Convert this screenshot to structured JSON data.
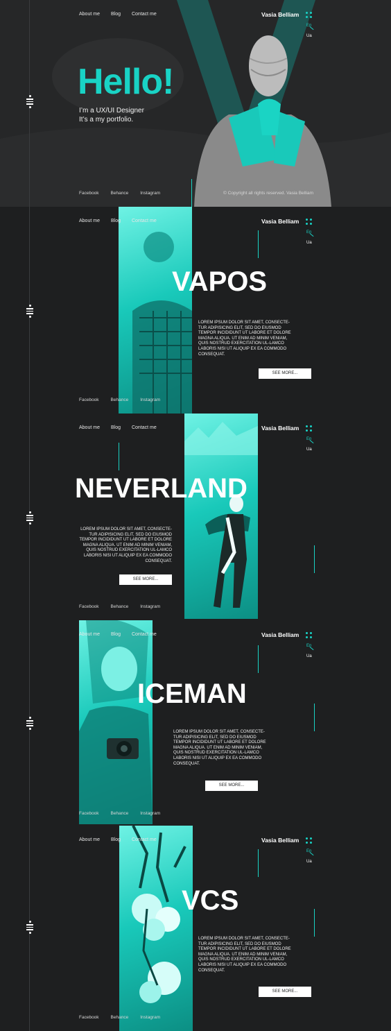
{
  "nav": {
    "about": "About me",
    "blog": "Blog",
    "contact": "Contact me"
  },
  "brand": "Vasia Belliam",
  "lang": {
    "en": "En",
    "ua": "Ua"
  },
  "social": {
    "facebook": "Facebook",
    "behance": "Behance",
    "instagram": "Instagram"
  },
  "hero": {
    "heading": "Hello!",
    "line1": "I’m a UX/UI Designer",
    "line2": "It’s a my portfolio.",
    "copyright": "© Copyright all rights reserved. Vasia Belliam"
  },
  "projects": [
    {
      "title": "VAPOS",
      "text": "LOREM IPSUM DOLOR SIT AMET, CONSECTE-TUR ADIPISICING ELIT, SED DO EIUSMOD TEMPOR INCIDIDUNT UT LABORE ET DOLORE MAGNA ALIQUA. UT ENIM AD MINIM VENIAM, QUIS NOSTRUD EXERCITATION UL-LAMCO LABORIS NISI UT ALIQUIP EX EA COMMODO CONSEQUAT.",
      "button": "SEE MORE..."
    },
    {
      "title": "NEVERLAND",
      "text": "LOREM IPSUM DOLOR SIT AMET, CONSECTE-TUR ADIPISICING ELIT, SED DO EIUSMOD TEMPOR INCIDIDUNT UT LABORE ET DOLORE MAGNA ALIQUA. UT ENIM AD MINIM VENIAM, QUIS NOSTRUD EXERCITATION UL-LAMCO LABORIS NISI UT ALIQUIP EX EA COMMODO CONSEQUAT.",
      "button": "SEE MORE..."
    },
    {
      "title": "ICEMAN",
      "text": "LOREM IPSUM DOLOR SIT AMET, CONSECTE-TUR ADIPISICING ELIT, SED DO EIUSMOD TEMPOR INCIDIDUNT UT LABORE ET DOLORE MAGNA ALIQUA. UT ENIM AD MINIM VENIAM, QUIS NOSTRUD EXERCITATION UL-LAMCO LABORIS NISI UT ALIQUIP EX EA COMMODO CONSEQUAT.",
      "button": "SEE MORE..."
    },
    {
      "title": "VCS",
      "text": "LOREM IPSUM DOLOR SIT AMET, CONSECTE-TUR ADIPISICING ELIT, SED DO EIUSMOD TEMPOR INCIDIDUNT UT LABORE ET DOLORE MAGNA ALIQUA. UT ENIM AD MINIM VENIAM, QUIS NOSTRUD EXERCITATION UL-LAMCO LABORIS NISI UT ALIQUIP EX EA COMMODO CONSEQUAT.",
      "button": "SEE MORE..."
    }
  ],
  "colors": {
    "accent": "#19d3c5",
    "background": "#1f2021",
    "button": "#ffffff"
  },
  "icons": {
    "menu": "hamburger-menu-icon",
    "grid": "grid-dots-icon"
  }
}
